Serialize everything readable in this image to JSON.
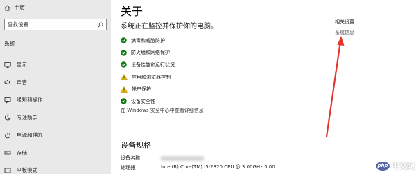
{
  "sidebar": {
    "home_label": "主页",
    "search_placeholder": "查找设置",
    "section_title": "系统",
    "items": [
      {
        "label": "显示",
        "icon": "display-icon"
      },
      {
        "label": "声音",
        "icon": "sound-icon"
      },
      {
        "label": "通知和操作",
        "icon": "notification-icon"
      },
      {
        "label": "专注助手",
        "icon": "focus-assist-icon"
      },
      {
        "label": "电源和睡眠",
        "icon": "power-icon"
      },
      {
        "label": "存储",
        "icon": "storage-icon"
      },
      {
        "label": "平板模式",
        "icon": "tablet-icon"
      }
    ]
  },
  "main": {
    "title": "关于",
    "status_header": "系统正在监控并保护你的电脑。",
    "protections": [
      {
        "label": "病毒和威胁防护",
        "status": "ok"
      },
      {
        "label": "防火墙和网络保护",
        "status": "ok"
      },
      {
        "label": "设备性能和运行状况",
        "status": "ok"
      },
      {
        "label": "应用和浏览器控制",
        "status": "warning"
      },
      {
        "label": "帐户保护",
        "status": "warning"
      },
      {
        "label": "设备安全性",
        "status": "ok"
      }
    ],
    "security_link": "在 Windows 安全中心中查看详细信息",
    "specs_title": "设备规格",
    "specs": [
      {
        "key": "设备名称",
        "value": ""
      },
      {
        "key": "处理器",
        "value": "Intel(R) Core(TM) i5-2320 CPU @ 3.00GHz   3.00"
      }
    ],
    "related_title": "相关设置",
    "related_link": "系统信息"
  },
  "colors": {
    "ok": "#107c10",
    "warning": "#f2c200",
    "arrow": "#e4342b"
  },
  "watermark": {
    "logo_text": "php",
    "text": "中文网"
  }
}
